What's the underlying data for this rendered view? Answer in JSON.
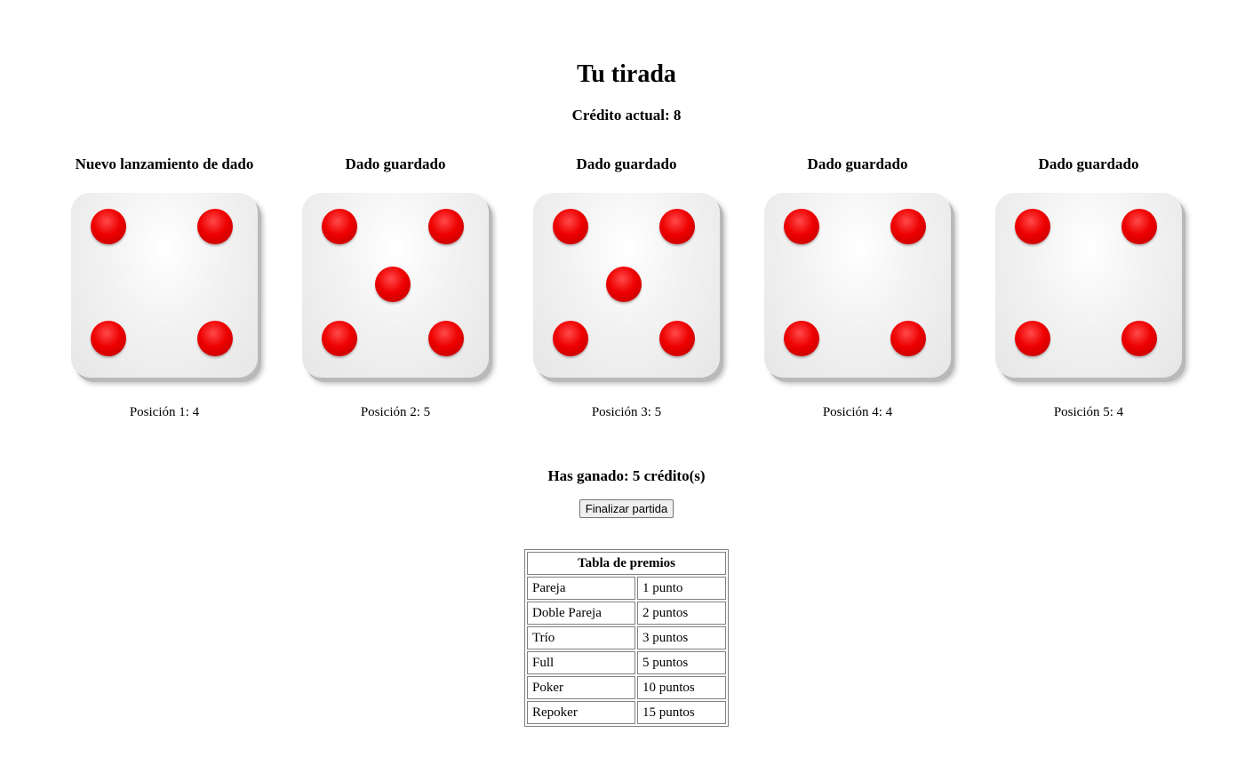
{
  "title": "Tu tirada",
  "credit": "Crédito actual: 8",
  "dice": [
    {
      "heading": "Nuevo lanzamiento de dado",
      "value": 4,
      "caption": "Posición 1: 4"
    },
    {
      "heading": "Dado guardado",
      "value": 5,
      "caption": "Posición 2: 5"
    },
    {
      "heading": "Dado guardado",
      "value": 5,
      "caption": "Posición 3: 5"
    },
    {
      "heading": "Dado guardado",
      "value": 4,
      "caption": "Posición 4: 4"
    },
    {
      "heading": "Dado guardado",
      "value": 4,
      "caption": "Posición 5: 4"
    }
  ],
  "won": "Has ganado: 5 crédito(s)",
  "finish_button": "Finalizar partida",
  "prize_table": {
    "caption": "Tabla de premios",
    "rows": [
      {
        "name": "Pareja",
        "points": "1 punto"
      },
      {
        "name": "Doble Pareja",
        "points": "2 puntos"
      },
      {
        "name": "Trío",
        "points": "3 puntos"
      },
      {
        "name": "Full",
        "points": "5 puntos"
      },
      {
        "name": "Poker",
        "points": "10 puntos"
      },
      {
        "name": "Repoker",
        "points": "15 puntos"
      }
    ]
  },
  "colors": {
    "pip": "#ee0000",
    "die_face": "#eeeeee"
  }
}
